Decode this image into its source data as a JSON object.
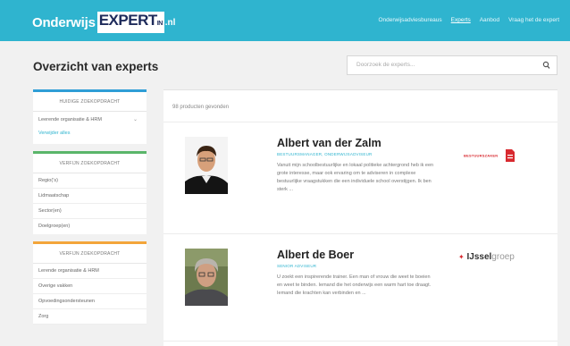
{
  "logo": {
    "part1": "Onderwijs",
    "part2": "EXPERT",
    "part2_small": "IN",
    "part3": ".nl"
  },
  "nav": {
    "items": [
      {
        "label": "Onderwijsadviesbureaus",
        "active": false
      },
      {
        "label": "Experts",
        "active": true
      },
      {
        "label": "Aanbod",
        "active": false
      },
      {
        "label": "Vraag het de expert",
        "active": false
      }
    ]
  },
  "page": {
    "title": "Overzicht van experts"
  },
  "search": {
    "placeholder": "Doorzoek de experts..."
  },
  "sidebar": {
    "box1": {
      "header": "HUIDIGE ZOEKOPDRACHT",
      "select_value": "Leerende organisatie & HRM",
      "reset_link": "Verwijder alles"
    },
    "box2": {
      "header": "VERFIJN ZOEKOPDRACHT",
      "items": [
        "Regio(’s)",
        "Lidmaatschap",
        "Sector(en)",
        "Doelgroep(en)"
      ]
    },
    "box3": {
      "header": "VERFIJN ZOEKOPDRACHT",
      "items": [
        "Lerende organisatie & HRM",
        "Overige vakken",
        "Opvoedingsondersteunen",
        "Zorg"
      ]
    }
  },
  "main": {
    "count": "98 producten gevonden",
    "experts": [
      {
        "name": "Albert van der Zalm",
        "role": "BESTUURSMANAGER, ONDERWIJSADVISEUR",
        "desc": "Vanuit mijn schoolbestuurlijke en lokaal politieke achtergrond heb ik een grote interesse, maar ook ervaring om te adviseren in complexe bestuurlijke vraagstukken die een individuele school overstijgen. Ik ben sterk ...",
        "brand": "BESTUURSZAKEN"
      },
      {
        "name": "Albert de Boer",
        "role": "SENIOR ADVISEUR",
        "desc": "U zoekt een inspirerende trainer. Een man of vrouw die weet te boeien en weet te binden. Iemand die het onderwijs een warm hart toe draagt. Iemand die krachten kan verbinden en ...",
        "brand_main": "IJssel",
        "brand_rest": "groep"
      }
    ]
  },
  "colors": {
    "accent": "#2fb4cf",
    "bar_blue": "#2f9ed6",
    "bar_green": "#5ab56a",
    "bar_orange": "#f3a53a",
    "brand_red": "#d8292f"
  }
}
